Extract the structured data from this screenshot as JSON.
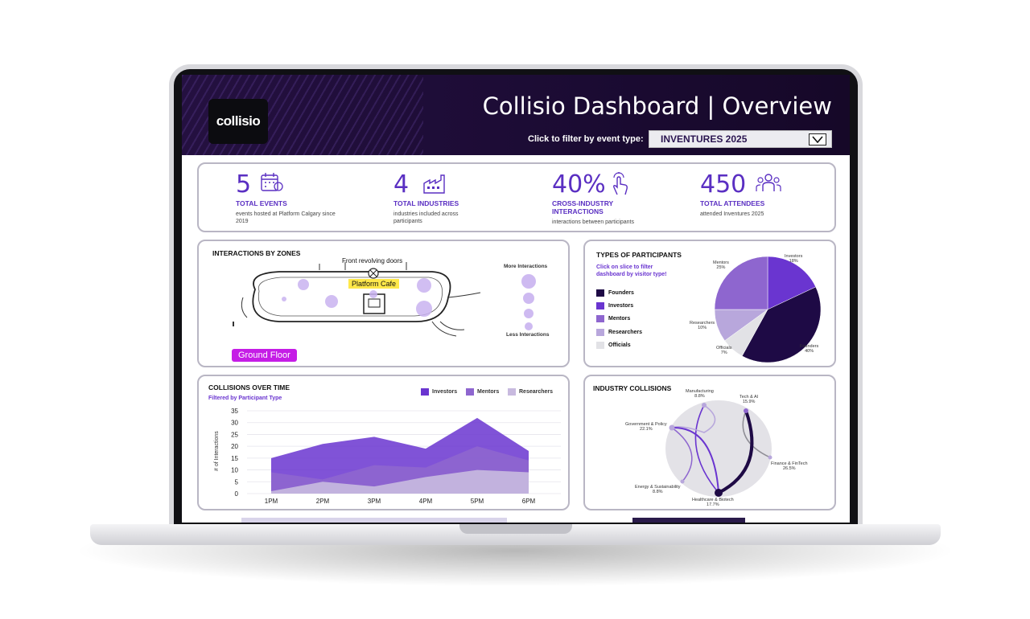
{
  "header": {
    "logo_text": "collisio",
    "title": "Collisio Dashboard | Overview",
    "filter_label": "Click to filter by event type:",
    "filter_value": "INVENTURES 2025"
  },
  "kpis": [
    {
      "value": "5",
      "label": "TOTAL EVENTS",
      "desc": "events hosted at Platform Calgary since 2019",
      "icon": "calendar-icon"
    },
    {
      "value": "4",
      "label": "TOTAL INDUSTRIES",
      "desc": "industries included across participants",
      "icon": "factory-icon"
    },
    {
      "value": "40%",
      "label": "CROSS-INDUSTRY INTERACTIONS",
      "desc": "interactions between participants",
      "icon": "tap-icon"
    },
    {
      "value": "450",
      "label": "TOTAL ATTENDEES",
      "desc": "attended Inventures 2025",
      "icon": "people-icon"
    }
  ],
  "zones": {
    "title": "INTERACTIONS BY ZONES",
    "doors_label": "Front revolving doors",
    "cafe_label": "Platform Cafe",
    "more_label": "More Interactions",
    "less_label": "Less Interactions",
    "floor_badge": "Ground Floor"
  },
  "participants": {
    "title": "TYPES OF PARTICIPANTS",
    "subtitle_line1": "Click on slice  to filter",
    "subtitle_line2": "dashboard by visitor type!",
    "legend": [
      {
        "label": "Founders",
        "color": "#1e0a45"
      },
      {
        "label": "Investors",
        "color": "#6a35d0"
      },
      {
        "label": "Mentors",
        "color": "#8e66cf"
      },
      {
        "label": "Researchers",
        "color": "#b8a7dc"
      },
      {
        "label": "Officials",
        "color": "#e2e2e6"
      }
    ],
    "slices": [
      {
        "name": "Investors",
        "pct": "18%",
        "value": 18,
        "color": "#6a35d0"
      },
      {
        "name": "Founders",
        "pct": "40%",
        "value": 40,
        "color": "#1e0a45"
      },
      {
        "name": "Officials",
        "pct": "7%",
        "value": 7,
        "color": "#e2e2e6"
      },
      {
        "name": "Researchers",
        "pct": "10%",
        "value": 10,
        "color": "#b8a7dc"
      },
      {
        "name": "Mentors",
        "pct": "25%",
        "value": 25,
        "color": "#8e66cf"
      }
    ]
  },
  "collisions": {
    "title": "COLLISIONS OVER TIME",
    "subtitle": "Filtered by Participant Type",
    "ylabel": "# of Interactions"
  },
  "industry": {
    "title": "INDUSTRY COLLISIONS",
    "nodes": [
      {
        "name": "Manufacturing",
        "pct": "8.8%"
      },
      {
        "name": "Tech & AI",
        "pct": "15.9%"
      },
      {
        "name": "Government & Policy",
        "pct": "22.1%"
      },
      {
        "name": "Finance & FinTech",
        "pct": "26.5%"
      },
      {
        "name": "Energy & Sustainability",
        "pct": "8.8%"
      },
      {
        "name": "Healthcare & Biotech",
        "pct": "17.7%"
      }
    ]
  },
  "chart_data": {
    "type": "area",
    "categories": [
      "1PM",
      "2PM",
      "3PM",
      "4PM",
      "5PM",
      "6PM"
    ],
    "series": [
      {
        "name": "Investors",
        "values": [
          15,
          21,
          24,
          19,
          32,
          18
        ],
        "color": "#6a35d0"
      },
      {
        "name": "Mentors",
        "values": [
          9,
          6,
          12,
          11,
          20,
          14
        ],
        "color": "#8e66cf"
      },
      {
        "name": "Researchers",
        "values": [
          1,
          5,
          3,
          7,
          10,
          9
        ],
        "color": "#c8badf"
      }
    ],
    "xlabel": "",
    "ylabel": "# of Interactions",
    "ylim": [
      0,
      35
    ],
    "yticks": [
      "0",
      "5",
      "10",
      "15",
      "20",
      "25",
      "30",
      "35"
    ],
    "grid": true,
    "legend": "top-right"
  }
}
